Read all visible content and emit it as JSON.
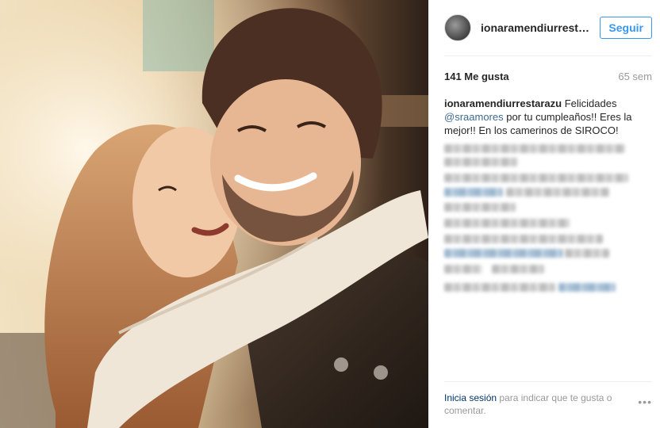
{
  "post": {
    "header": {
      "username": "ionaramendiurrestar...",
      "follow_label": "Seguir"
    },
    "stats": {
      "likes": "141 Me gusta",
      "age": "65 sem"
    },
    "caption": {
      "username": "ionaramendiurrestarazu",
      "text_1": " Felicidades ",
      "mention": "@sraamores",
      "text_2": " por tu cumpleaños!! Eres la mejor!! En los camerinos de SIROCO!"
    },
    "footer": {
      "login_link": "Inicia sesión",
      "login_text": " para indicar que te gusta o comentar.",
      "more_label": "•••"
    }
  }
}
